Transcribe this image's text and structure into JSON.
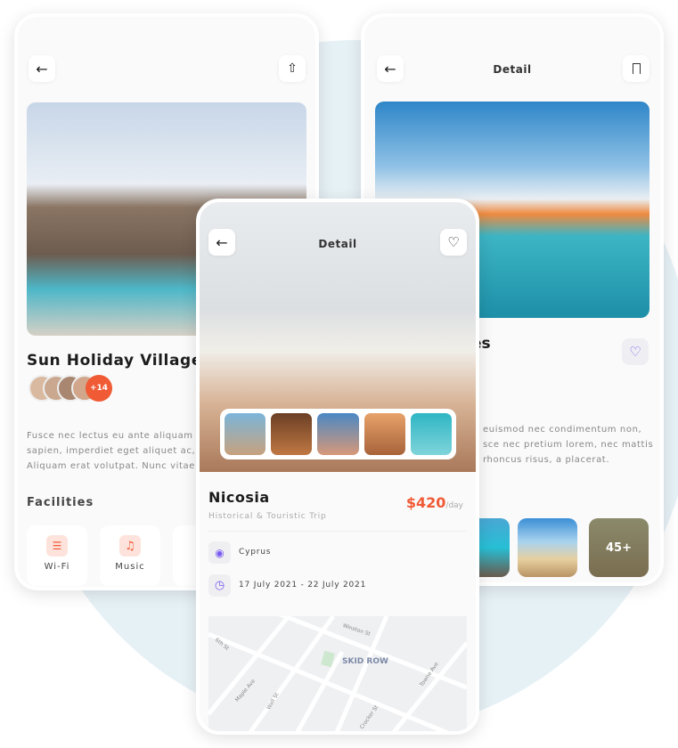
{
  "left": {
    "title": "Sun Holiday Village",
    "more_people": "+14",
    "paragraph": [
      "Fusce nec lectus eu ante aliquam",
      "sapien, imperdiet eget aliquet ac,",
      "Aliquam erat volutpat. Nunc vitae"
    ],
    "facilities_title": "Facilities",
    "facilities": [
      {
        "label": "Wi-Fi",
        "icon": "wifi-icon"
      },
      {
        "label": "Music",
        "icon": "music-icon"
      }
    ]
  },
  "right": {
    "header": "Detail",
    "title_fragment": "es",
    "paragraph": [
      "euismod nec condimentum non,",
      "sce nec pretium lorem, nec mattis",
      "rhoncus risus, a placerat."
    ],
    "more_photos": "45+"
  },
  "middle": {
    "header": "Detail",
    "name": "Nicosia",
    "subtitle": "Historical & Touristic Trip",
    "price": "$420",
    "price_unit": "/day",
    "location": "Cyprus",
    "dates": "17 July 2021 - 22 July 2021",
    "map": {
      "district": "SKID ROW",
      "streets": [
        "Winston St",
        "6th St",
        "Maple Ave",
        "Wall St",
        "Towne Ave",
        "Crocker St"
      ]
    }
  },
  "colors": {
    "accent": "#f05a35",
    "purple": "#7a5cf0"
  }
}
